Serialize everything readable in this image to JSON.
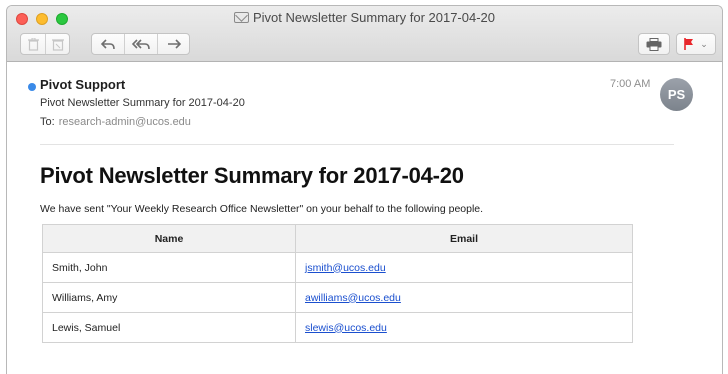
{
  "window": {
    "title": "Pivot Newsletter Summary for 2017-04-20"
  },
  "toolbar": {
    "icons": [
      "trash-icon",
      "junk-icon",
      "reply-icon",
      "reply-all-icon",
      "forward-icon",
      "print-icon",
      "flag-icon"
    ],
    "flag_color": "#e8262b"
  },
  "message": {
    "sender": "Pivot Support",
    "subject": "Pivot Newsletter Summary for 2017-04-20",
    "to_label": "To:",
    "to_address": "research-admin@ucos.edu",
    "time": "7:00 AM",
    "avatar_initials": "PS",
    "unread_color": "#3a8ae8"
  },
  "body": {
    "title": "Pivot Newsletter Summary for 2017-04-20",
    "intro": "We have sent \"Your Weekly Research Office Newsletter\" on your behalf to the following people.",
    "table": {
      "headers": [
        "Name",
        "Email"
      ],
      "rows": [
        {
          "name": "Smith, John",
          "email": "jsmith@ucos.edu"
        },
        {
          "name": "Williams, Amy",
          "email": "awilliams@ucos.edu"
        },
        {
          "name": "Lewis, Samuel",
          "email": "slewis@ucos.edu"
        }
      ]
    }
  }
}
